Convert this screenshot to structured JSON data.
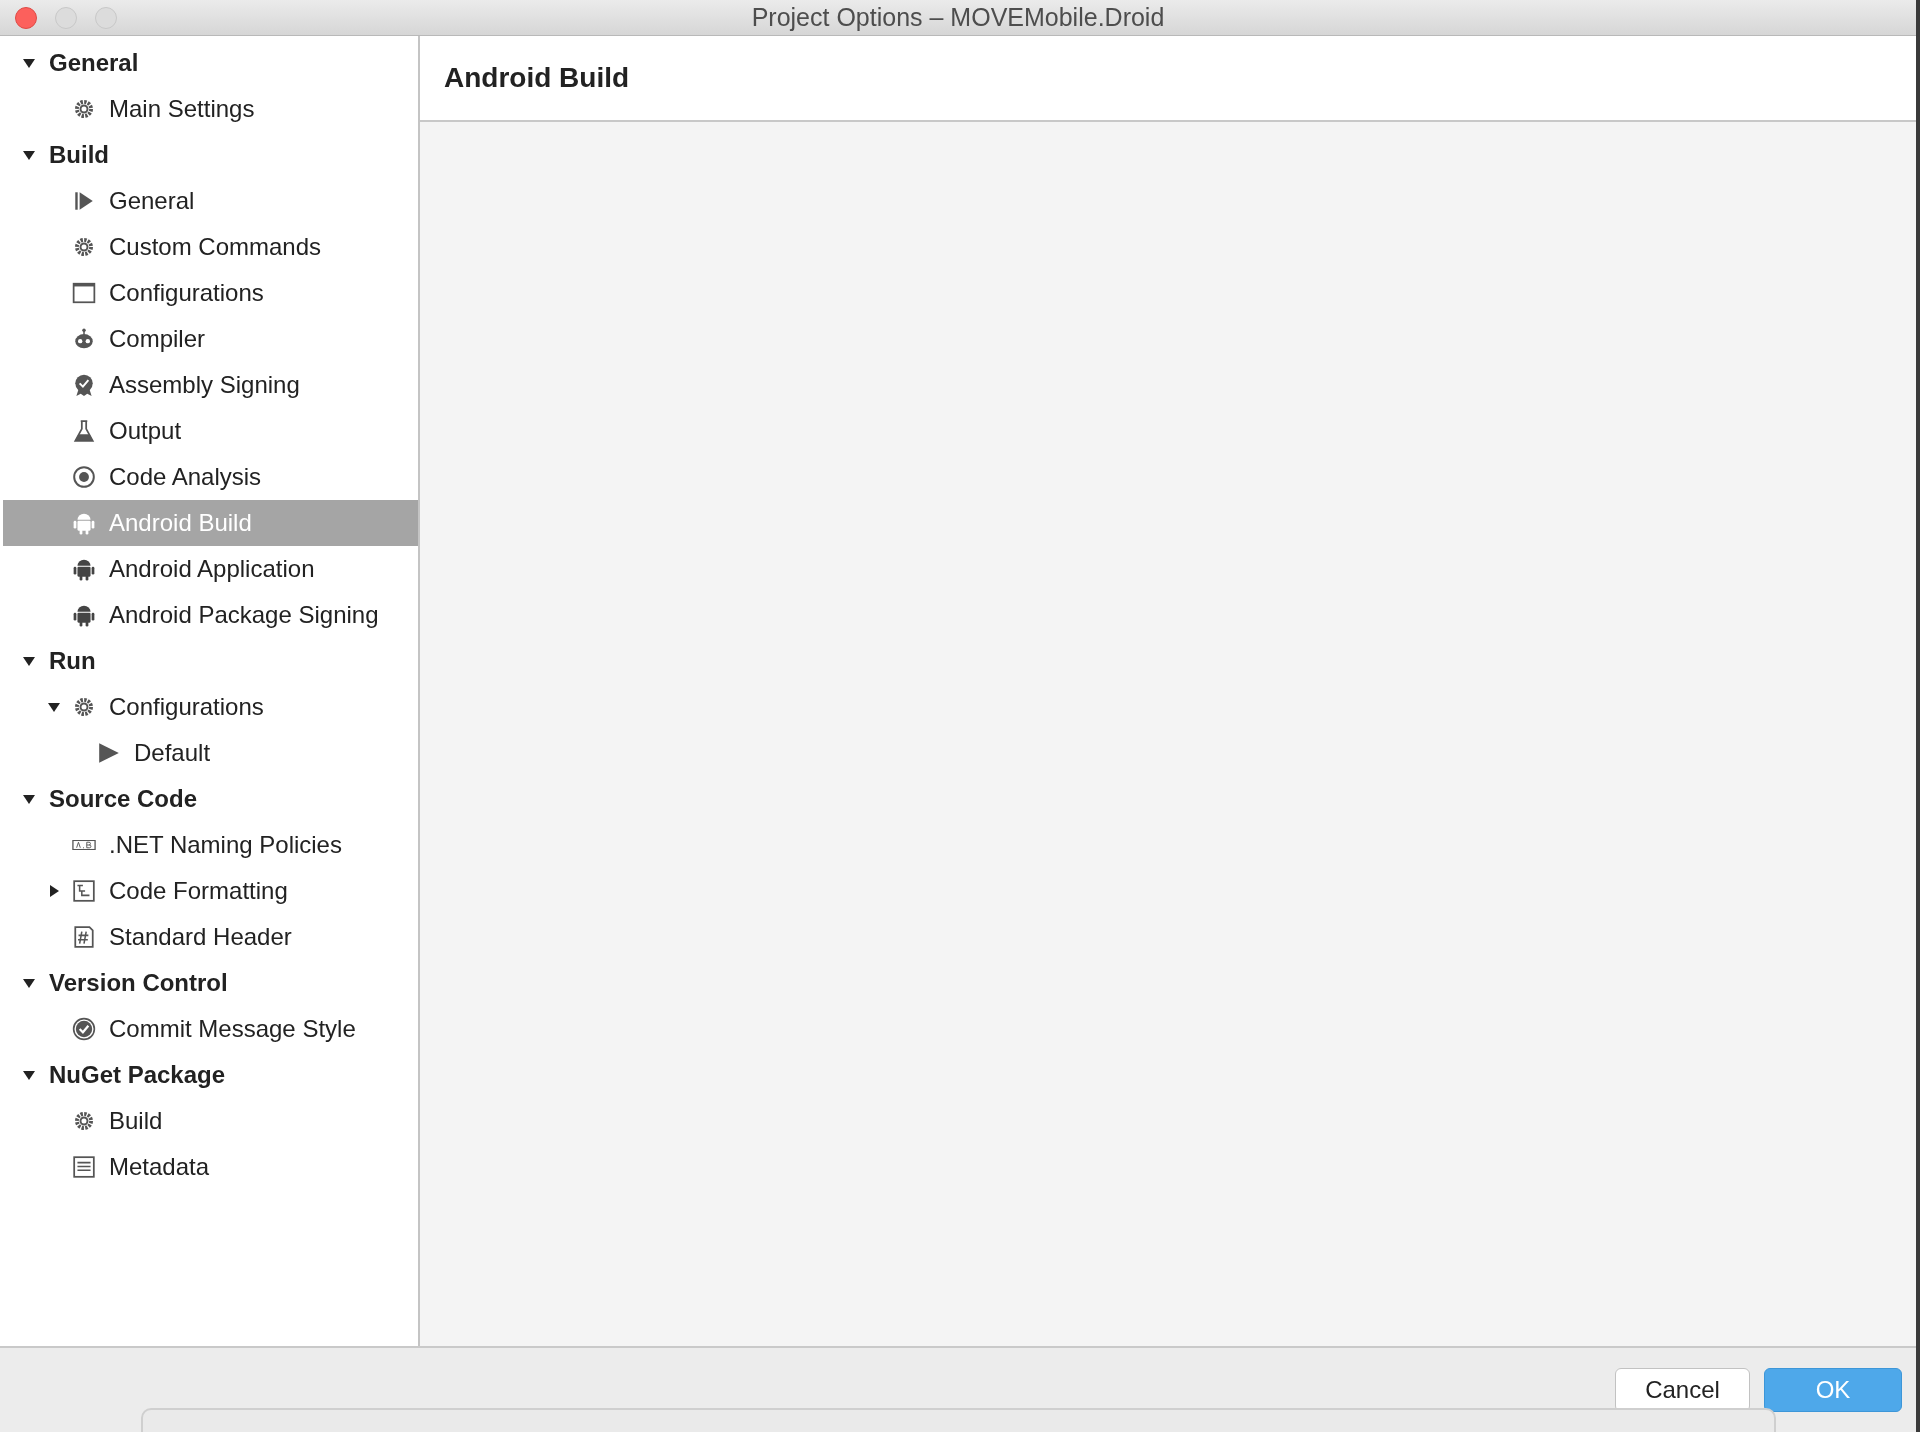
{
  "window": {
    "title": "Project Options – MOVEMobile.Droid"
  },
  "sidebar": {
    "tree": [
      {
        "label": "General",
        "expanded": true,
        "selected": false,
        "children": [
          {
            "label": "Main Settings",
            "kind": "gear",
            "selected": false
          }
        ]
      },
      {
        "label": "Build",
        "expanded": true,
        "selected": false,
        "children": [
          {
            "label": "General",
            "kind": "play-bar",
            "selected": false
          },
          {
            "label": "Custom Commands",
            "kind": "gear",
            "selected": false
          },
          {
            "label": "Configurations",
            "kind": "window",
            "selected": false
          },
          {
            "label": "Compiler",
            "kind": "robot",
            "selected": false
          },
          {
            "label": "Assembly Signing",
            "kind": "badge",
            "selected": false
          },
          {
            "label": "Output",
            "kind": "flask",
            "selected": false
          },
          {
            "label": "Code Analysis",
            "kind": "radio",
            "selected": false
          },
          {
            "label": "Android Build",
            "kind": "android",
            "selected": true
          },
          {
            "label": "Android Application",
            "kind": "android",
            "selected": false
          },
          {
            "label": "Android Package Signing",
            "kind": "android",
            "selected": false
          }
        ]
      },
      {
        "label": "Run",
        "expanded": true,
        "selected": false,
        "children": [
          {
            "label": "Configurations",
            "kind": "gear",
            "selected": false,
            "expanded": true,
            "children": [
              {
                "label": "Default",
                "kind": "play",
                "selected": false
              }
            ]
          }
        ]
      },
      {
        "label": "Source Code",
        "expanded": true,
        "selected": false,
        "children": [
          {
            "label": ".NET Naming Policies",
            "kind": "ab",
            "selected": false
          },
          {
            "label": "Code Formatting",
            "kind": "tree-doc",
            "selected": false,
            "expanded": false
          },
          {
            "label": "Standard Header",
            "kind": "hash-doc",
            "selected": false
          }
        ]
      },
      {
        "label": "Version Control",
        "expanded": true,
        "selected": false,
        "children": [
          {
            "label": "Commit Message Style",
            "kind": "check-circle",
            "selected": false
          }
        ]
      },
      {
        "label": "NuGet Package",
        "expanded": true,
        "selected": false,
        "children": [
          {
            "label": "Build",
            "kind": "gear",
            "selected": false
          },
          {
            "label": "Metadata",
            "kind": "list-doc",
            "selected": false
          }
        ]
      }
    ]
  },
  "panel": {
    "title": "Android Build"
  },
  "buttons": [
    {
      "label": "Cancel",
      "kind": "normal"
    },
    {
      "label": "OK",
      "kind": "default"
    }
  ]
}
